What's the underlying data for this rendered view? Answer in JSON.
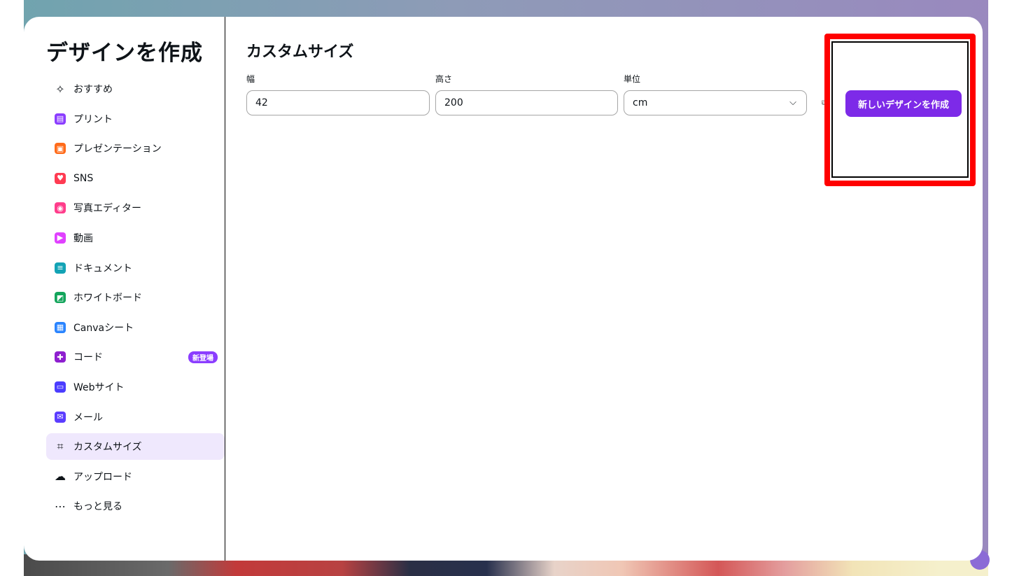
{
  "dialog": {
    "title": "デザインを作成"
  },
  "sidebar": {
    "items": [
      {
        "label": "おすすめ",
        "icon": "sparkle-icon",
        "color": "#0e1318"
      },
      {
        "label": "プリント",
        "icon": "printer-icon",
        "color": "#8b3dff"
      },
      {
        "label": "プレゼンテーション",
        "icon": "presentation-icon",
        "color": "#ff6b1a"
      },
      {
        "label": "SNS",
        "icon": "heart-chat-icon",
        "color": "#ff3b52"
      },
      {
        "label": "写真エディター",
        "icon": "camera-icon",
        "color": "#ff3d8b"
      },
      {
        "label": "動画",
        "icon": "video-icon",
        "color": "#e041ff"
      },
      {
        "label": "ドキュメント",
        "icon": "document-icon",
        "color": "#13a3b5"
      },
      {
        "label": "ホワイトボード",
        "icon": "whiteboard-icon",
        "color": "#14a55c"
      },
      {
        "label": "Canvaシート",
        "icon": "sheet-icon",
        "color": "#2a84ff"
      },
      {
        "label": "コード",
        "icon": "code-icon",
        "color": "#8e1fcf",
        "badge": "新登場"
      },
      {
        "label": "Webサイト",
        "icon": "website-icon",
        "color": "#4b3dff"
      },
      {
        "label": "メール",
        "icon": "mail-icon",
        "color": "#5b3dff"
      },
      {
        "label": "カスタムサイズ",
        "icon": "custom-size-icon",
        "color": "#0e1318",
        "active": true
      },
      {
        "label": "アップロード",
        "icon": "cloud-upload-icon",
        "color": "#0e1318"
      },
      {
        "label": "もっと見る",
        "icon": "more-icon",
        "color": "#0e1318"
      }
    ]
  },
  "main": {
    "title": "カスタムサイズ",
    "width": {
      "label": "幅",
      "value": "42"
    },
    "height": {
      "label": "高さ",
      "value": "200"
    },
    "unit": {
      "label": "単位",
      "value": "cm"
    },
    "create_button": "新しいデザインを作成"
  },
  "colors": {
    "accent": "#7d2ae8",
    "highlight": "#ff0000"
  }
}
